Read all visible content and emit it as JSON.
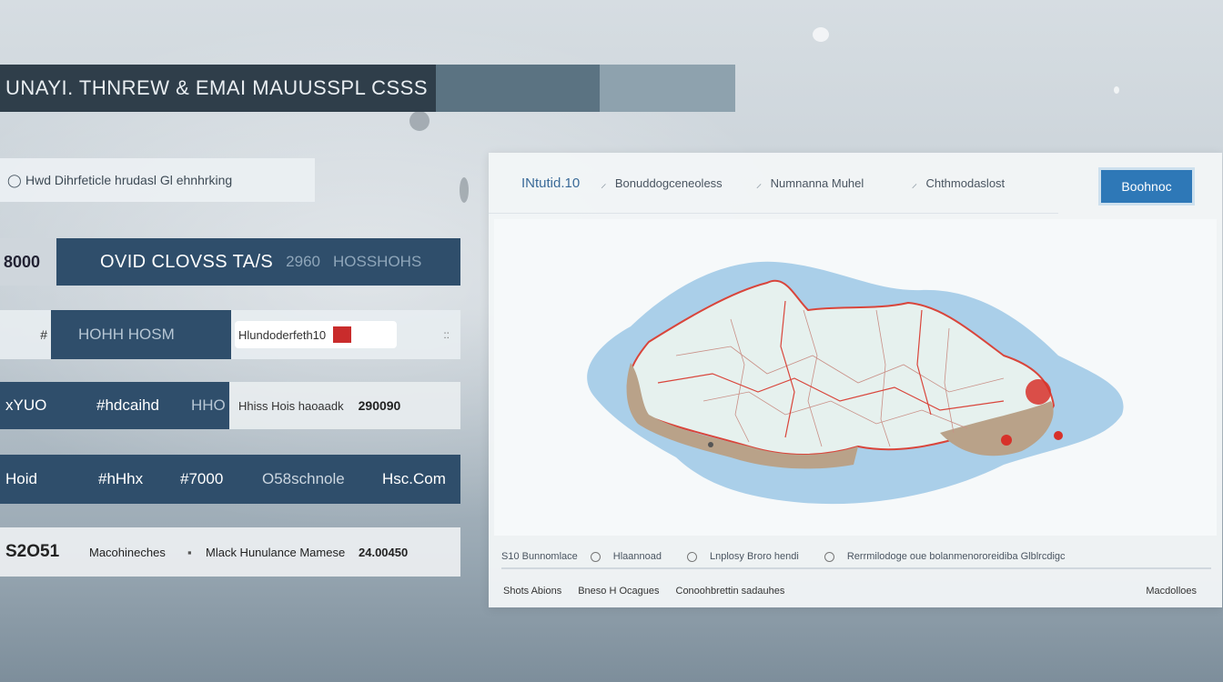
{
  "title": "UNAYI. THNREW & EMAI MAUUSSPL CSSS",
  "filter_text": "Hwd Dihrfeticle hrudasl Gl ehnhrking",
  "rows": {
    "r1": {
      "tag": "8000",
      "main": "OVID CLOVSS TA/S",
      "sub1": "2960",
      "sub2": "HOSSHOHS"
    },
    "r2": {
      "lead": "#",
      "dark": "HOHH HOSM",
      "pill": "Hlundoderfeth10",
      "end": "::"
    },
    "r3": {
      "a": "xYUO",
      "b": "#hdcaihd",
      "c": "HHO",
      "t1": "Hhiss Hois haoaadk",
      "t2": "290090"
    },
    "r4": {
      "a": "Hoid",
      "b": "#hHhx",
      "c": "#7000",
      "d": "O58schnole",
      "e": "Hsc.Com"
    },
    "r5": {
      "a": "S2O51",
      "b": "Macohineches",
      "dot": "▪",
      "c": "Mlack Hunulance Mamese",
      "d": "24.00450"
    }
  },
  "panel": {
    "brand": "INtutid.10",
    "toolbar_items": [
      "Bonuddogceneoless",
      "Numnanna Muhel",
      "Chthmodaslost"
    ],
    "action_label": "Boohnoc",
    "footer1": [
      "S10 Bunnomlace",
      "Hlaannoad",
      "Lnplosy Broro hendi",
      "Rerrmilodoge oue bolanmenororeidiba Glblrcdigc"
    ],
    "footer2": [
      "Shots Abions",
      "Bneso H Ocagues",
      "Conoohbrettin sadauhes"
    ],
    "footer2_right": "Macdolloes"
  },
  "colors": {
    "accent": "#2e78b7",
    "row_dark": "#2f4e6b",
    "marker": "#d7312a"
  },
  "icons": {
    "filter": "circle-icon",
    "flag": "flag-icon",
    "marker": "map-pin-icon"
  }
}
